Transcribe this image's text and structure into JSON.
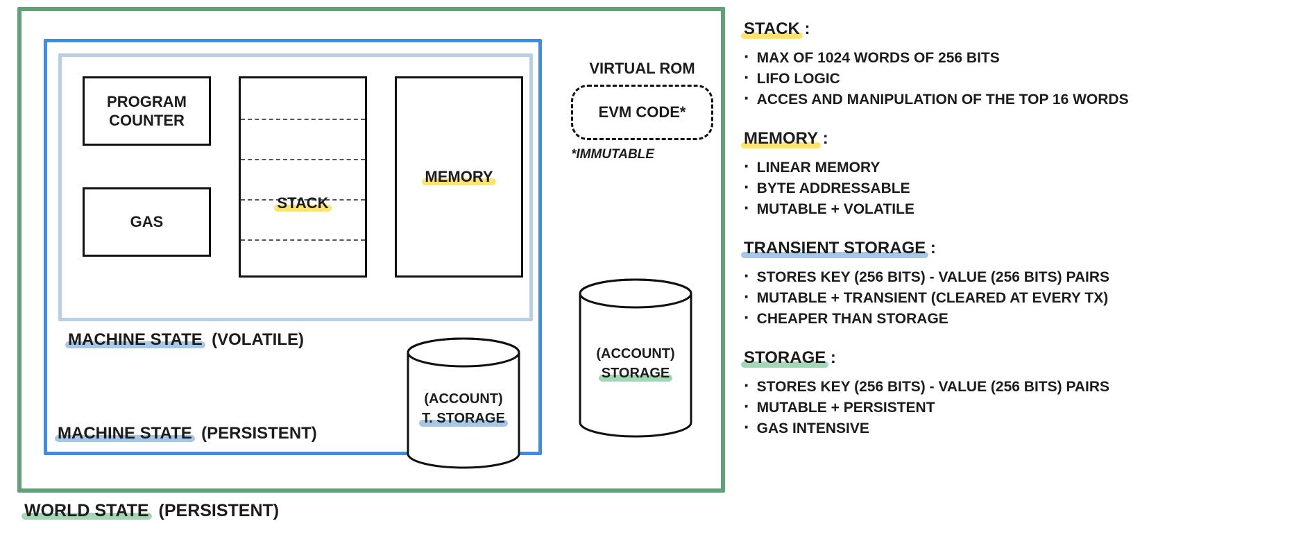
{
  "diagram": {
    "world_label": "WORLD STATE",
    "world_note": "(PERSISTENT)",
    "persistent_label": "MACHINE STATE",
    "persistent_note": "(PERSISTENT)",
    "volatile_label": "MACHINE STATE",
    "volatile_note": "(VOLATILE)",
    "program_counter": "PROGRAM COUNTER",
    "gas": "GAS",
    "stack": "STACK",
    "memory": "MEMORY",
    "vrom_title": "VIRTUAL ROM",
    "vrom_box": "EVM CODE*",
    "vrom_note": "*IMMUTABLE",
    "tstorage_line1": "(ACCOUNT)",
    "tstorage_line2": "T. STORAGE",
    "storage_line1": "(ACCOUNT)",
    "storage_line2": "STORAGE"
  },
  "key": {
    "stack": {
      "title": "STACK",
      "items": [
        "MAX OF 1024 WORDS OF 256 BITS",
        "LIFO LOGIC",
        "ACCES AND MANIPULATION OF THE TOP 16 WORDS"
      ]
    },
    "memory": {
      "title": "MEMORY",
      "items": [
        "LINEAR MEMORY",
        "BYTE ADDRESSABLE",
        "MUTABLE + VOLATILE"
      ]
    },
    "tstorage": {
      "title": "TRANSIENT STORAGE",
      "items": [
        "STORES KEY (256 BITS) - VALUE (256 BITS) PAIRS",
        "MUTABLE + TRANSIENT (CLEARED AT EVERY TX)",
        "CHEAPER THAN STORAGE"
      ]
    },
    "storage": {
      "title": "STORAGE",
      "items": [
        "STORES KEY (256 BITS) - VALUE (256 BITS) PAIRS",
        "MUTABLE + PERSISTENT",
        "GAS INTENSIVE"
      ]
    }
  }
}
